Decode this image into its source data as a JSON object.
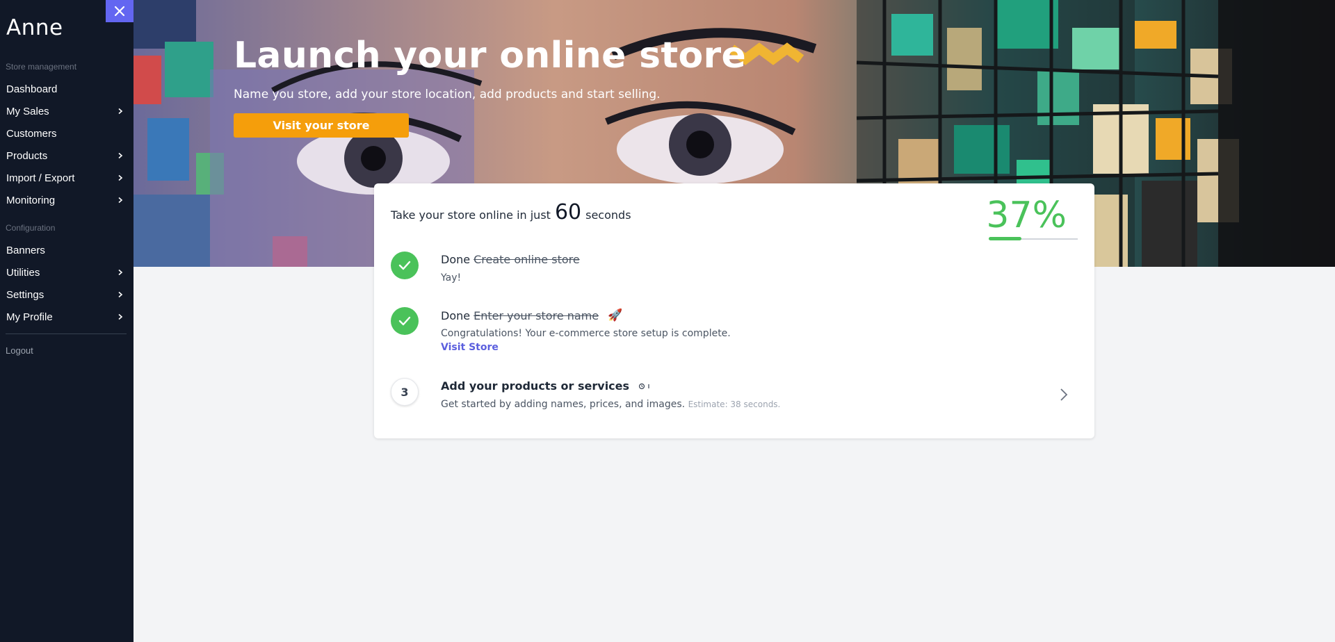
{
  "sidebar": {
    "brand": "Anne",
    "sections": [
      {
        "label": "Store management"
      },
      {
        "label": "Configuration"
      }
    ],
    "items": [
      {
        "label": "Dashboard",
        "has_submenu": false
      },
      {
        "label": "My Sales",
        "has_submenu": true
      },
      {
        "label": "Customers",
        "has_submenu": false
      },
      {
        "label": "Products",
        "has_submenu": true
      },
      {
        "label": "Import / Export",
        "has_submenu": true
      },
      {
        "label": "Monitoring",
        "has_submenu": true
      },
      {
        "label": "Banners",
        "has_submenu": false
      },
      {
        "label": "Utilities",
        "has_submenu": true
      },
      {
        "label": "Settings",
        "has_submenu": true
      },
      {
        "label": "My Profile",
        "has_submenu": true
      }
    ],
    "logout": "Logout"
  },
  "hero": {
    "title": "Launch your online store",
    "subtitle": "Name you store, add your store location, add products and start selling.",
    "button": "Visit your store"
  },
  "card": {
    "heading_pre": "Take your store online in just",
    "heading_num": "60",
    "heading_post": "seconds",
    "percent": "37%",
    "progress": 0.37,
    "steps": [
      {
        "status": "Done",
        "title": "Create online store",
        "desc": "Yay!"
      },
      {
        "status": "Done",
        "title": "Enter your store name",
        "emoji": "🚀",
        "desc": "Congratulations! Your e-commerce store setup is complete.",
        "link": "Visit Store"
      },
      {
        "number": "3",
        "title": "Add your products or services",
        "desc": "Get started by adding names, prices, and images.",
        "estimate": "Estimate: 38 seconds."
      }
    ]
  },
  "colors": {
    "sidebar_bg": "#111827",
    "accent": "#6366f1",
    "orange": "#f59e0b",
    "success": "#4ac25a",
    "link": "#5b5fde"
  }
}
